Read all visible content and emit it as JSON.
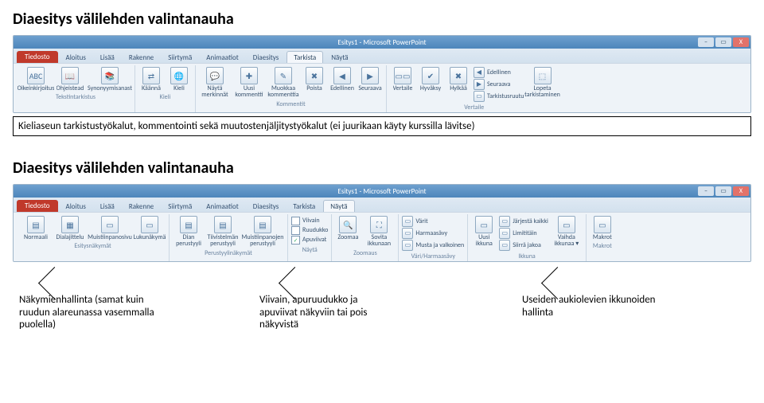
{
  "titles": {
    "section1": "Diaesitys välilehden valintanauha",
    "section2": "Diaesitys välilehden valintanauha"
  },
  "window": {
    "title": "Esitys1 - Microsoft PowerPoint",
    "min": "–",
    "max": "▭",
    "close": "X"
  },
  "tabs": {
    "file": "Tiedosto",
    "list": [
      "Aloitus",
      "Lisää",
      "Rakenne",
      "Siirtymä",
      "Animaatiot",
      "Diaesitys",
      "Tarkista",
      "Näytä"
    ]
  },
  "ribbon1": {
    "active_tab": "Tarkista",
    "groups": [
      {
        "label": "Tekstintarkistus",
        "big": [
          {
            "icon": "ABC",
            "label": "Oikeinkirjoitus"
          },
          {
            "icon": "📖",
            "label": "Ohjeistead"
          },
          {
            "icon": "📚",
            "label": "Synonyymisanasto"
          }
        ]
      },
      {
        "label": "Kieli",
        "big": [
          {
            "icon": "⇄",
            "label": "Käännä"
          },
          {
            "icon": "🌐",
            "label": "Kieli"
          }
        ]
      },
      {
        "label": "Kommentit",
        "big": [
          {
            "icon": "💬",
            "label": "Näytä merkinnät"
          },
          {
            "icon": "✚",
            "label": "Uusi kommentti"
          },
          {
            "icon": "✎",
            "label": "Muokkaa kommenttia"
          },
          {
            "icon": "✖",
            "label": "Poista"
          },
          {
            "icon": "◀",
            "label": "Edellinen"
          },
          {
            "icon": "▶",
            "label": "Seuraava"
          }
        ]
      },
      {
        "label": "Vertaile",
        "big": [
          {
            "icon": "▭▭",
            "label": "Vertaile"
          },
          {
            "icon": "✔",
            "label": "Hyväksy"
          },
          {
            "icon": "✖",
            "label": "Hylkää"
          }
        ],
        "rows": [
          {
            "icon": "◀",
            "label": "Edellinen"
          },
          {
            "icon": "▶",
            "label": "Seuraava"
          },
          {
            "icon": "▭",
            "label": "Tarkistusruutu"
          }
        ],
        "extra_big": [
          {
            "icon": "⬚",
            "label": "Lopeta tarkistaminen"
          }
        ]
      }
    ]
  },
  "desc1": "Kieliaseun tarkistustyökalut, kommentointi sekä muutostenjäljitystyökalut (ei juurikaan käyty kurssilla lävitse)",
  "ribbon2": {
    "active_tab": "Näytä",
    "groups": [
      {
        "label": "Esitysnäkymät",
        "big": [
          {
            "icon": "▤",
            "label": "Normaali"
          },
          {
            "icon": "▦",
            "label": "Dialajittelu"
          },
          {
            "icon": "▭",
            "label": "Muistiinpanosivu"
          },
          {
            "icon": "▭",
            "label": "Lukunäkymä"
          }
        ]
      },
      {
        "label": "Perustyylinäkymät",
        "big": [
          {
            "icon": "▤",
            "label": "Dian perustyyli"
          },
          {
            "icon": "▤",
            "label": "Tiivistelmän perustyyli"
          },
          {
            "icon": "▤",
            "label": "Muistiinpanojen perustyyli"
          }
        ]
      },
      {
        "label": "Näytä",
        "rows": [
          {
            "chk": false,
            "label": "Viivain"
          },
          {
            "chk": false,
            "label": "Ruudukko"
          },
          {
            "chk": true,
            "label": "Apuviivat"
          }
        ]
      },
      {
        "label": "Zoomaus",
        "big": [
          {
            "icon": "🔍",
            "label": "Zoomaa"
          },
          {
            "icon": "⛶",
            "label": "Sovita ikkunaan"
          }
        ]
      },
      {
        "label": "Väri/Harmaasävy",
        "rows": [
          {
            "icon": "▭",
            "label": "Värit"
          },
          {
            "icon": "▭",
            "label": "Harmaasävy"
          },
          {
            "icon": "▭",
            "label": "Musta ja valkoinen"
          }
        ]
      },
      {
        "label": "Ikkuna",
        "big": [
          {
            "icon": "▭",
            "label": "Uusi ikkuna"
          }
        ],
        "rows": [
          {
            "icon": "▭",
            "label": "Järjestä kaikki"
          },
          {
            "icon": "▭",
            "label": "Limititäin"
          },
          {
            "icon": "▭",
            "label": "Siirrä jakoa"
          }
        ],
        "extra_big": [
          {
            "icon": "▭",
            "label": "Vaihda ikkunaa ▾"
          }
        ]
      },
      {
        "label": "Makrot",
        "big": [
          {
            "icon": "▭",
            "label": "Makrot"
          }
        ]
      }
    ]
  },
  "callouts": {
    "c1": "Näkymienhallinta (samat kuin ruudun alareunassa vasemmalla puolella)",
    "c2": "Viivain, apuruudukko ja apuviivat näkyviin tai pois näkyvistä",
    "c3": "Useiden aukiolevien ikkunoiden hallinta"
  }
}
